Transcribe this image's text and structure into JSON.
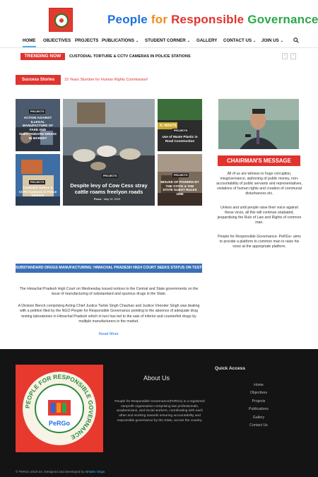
{
  "header": {
    "logo_name": "perco-logo",
    "title_parts": [
      {
        "text": "People ",
        "color": "#1d6fe0"
      },
      {
        "text": "for ",
        "color": "#f28a1a"
      },
      {
        "text": "Responsible ",
        "color": "#e0332e"
      },
      {
        "text": "Governance",
        "color": "#2aa84a"
      }
    ]
  },
  "nav": {
    "items": [
      {
        "label": "HOME",
        "active": true
      },
      {
        "label": "OBJECTIVES"
      },
      {
        "label": "PROJECTS"
      },
      {
        "label": "PUBLICATIONS",
        "dropdown": true
      },
      {
        "label": "STUDENT CORNER",
        "dropdown": true
      },
      {
        "label": "GALLERY"
      },
      {
        "label": "CONTACT US",
        "dropdown": true
      },
      {
        "label": "JOIN US",
        "dropdown": true
      }
    ],
    "search_icon": "search-icon"
  },
  "trending": {
    "label": "TRENDING NOW",
    "headline": "CUSTODIAL TORTURE & CCTV CAMERAS IN POLICE STATIONS",
    "prev_icon": "chevron-left-icon",
    "next_icon": "chevron-right-icon"
  },
  "success": {
    "label": "Success Stories",
    "text": "15 Years Slumber for Human Rights Commission!"
  },
  "grid": {
    "card1": {
      "tag": "PROJECTS",
      "title": "ACTION AGAINST ILLEGAL MANUFACTURE OF FAKE AND SUBSTANDARD DRUGS IN MARKET"
    },
    "card2": {
      "tag": "PROJECTS",
      "title": "Custodial Torture & CCTV Cameras in Police Stations"
    },
    "main": {
      "tag": "PROJECTS",
      "title": "Despite levy of Cow Cess stray cattle roams freelyon roads",
      "author": "Perco",
      "date": "May 19, 2023"
    },
    "card3": {
      "tag": "PROJECTS",
      "title": "Use of Waste Plastic in Road Construction",
      "overlay": "IC WASTE"
    },
    "card4": {
      "tag": "PROJECTS",
      "title": "MISUSE OF POWERS BY THE STATE & THE STATE GUEST RULES 1996"
    }
  },
  "chairman": {
    "heading": "CHAIRMAN'S MESSAGE",
    "p1": "All of us are witness to huge corruption, misgovernance, siphoning of public money, non-accountability of public servants and representatives, violations of human rights and creation of communal disturbances etc.",
    "p2": "Unless and until people raise their voice against these vices, all this will continue unabated, jeopardising the Rule of Law and Rights of common man.",
    "p3": "People for Responsible Governance- PeRGo- aims to provide a platform to common man to raise his voice at the appropriate platform."
  },
  "article": {
    "title": "SUBSTANDARD DRUGS MANUFACTURING: HIMACHAL PRADESH HIGH COURT SEEKS STATUS ON TESTING LABS",
    "p1": "The Himachal Pradesh High Court on Wednesday issued notices to the Central and State governments on the issue of manufacturing of substandard and spurious drugs in the State.",
    "p2": "A Division Bench comprising Acting Chief Justice Tarlok Singh Chauhan and Justice Virender Singh was dealing with a petition filed by the NGO People for Responsible Governance pointing to the absence of adequate drug testing laboratories in Himachal Pradesh which in turn has led to the sale of inferior and counterfeit drugs by multiple manufacturers in the market.",
    "read_more": "Read More"
  },
  "footer": {
    "logo_ring_text": "PEOPLE FOR RESPONSIBLE GOVERNANCE",
    "logo_brand": "PeRGo",
    "about_heading": "About Us",
    "about_text": "People for Responsible Governance(PeRGo) is a registered nonprofit organisation comprising law professionals, academicians, and social workers, coordinating with each other and working towards ensuring accountability and responsible governance by the State, across the country.",
    "quick_heading": "Quick Access",
    "links": [
      "Home",
      "Objectives",
      "Projects",
      "Publications",
      "Gallery",
      "Contact Us"
    ],
    "copyright": "© PeRGo 2023-24. Designed and developed by",
    "developer": "Ishtdev Sings"
  }
}
